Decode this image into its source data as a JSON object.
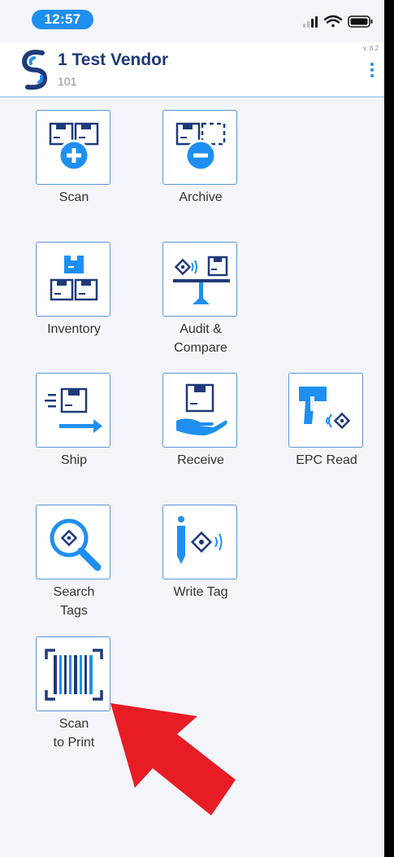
{
  "status_bar": {
    "time": "12:57"
  },
  "header": {
    "vendor_name": "1 Test Vendor",
    "vendor_code": "101",
    "version": "v. 8.2",
    "menu_icon": "more-vertical-icon"
  },
  "tiles": [
    {
      "label": "Scan",
      "icon": "scan-add-boxes-icon"
    },
    {
      "label": "Archive",
      "icon": "archive-remove-box-icon"
    },
    {
      "label": "Inventory",
      "icon": "inventory-stacked-boxes-icon"
    },
    {
      "label": "Audit &\nCompare",
      "icon": "audit-scale-icon"
    },
    {
      "label": "Ship",
      "icon": "ship-box-arrow-icon"
    },
    {
      "label": "Receive",
      "icon": "receive-box-hand-icon"
    },
    {
      "label": "EPC Read",
      "icon": "epc-reader-gun-icon"
    },
    {
      "label": "Search\nTags",
      "icon": "search-tag-magnifier-icon"
    },
    {
      "label": "Write Tag",
      "icon": "write-tag-pen-icon"
    },
    {
      "label": "Scan\nto Print",
      "icon": "barcode-scan-icon"
    }
  ],
  "colors": {
    "accent": "#1e8ff0",
    "dark_blue": "#1e3a7a",
    "arrow": "#e81c24"
  }
}
